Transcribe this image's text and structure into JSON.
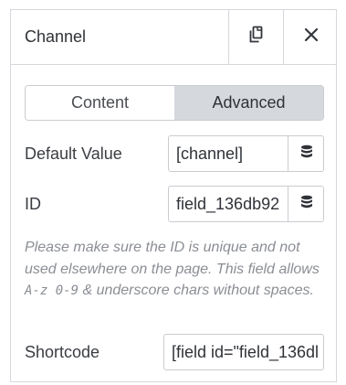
{
  "header": {
    "title": "Channel"
  },
  "tabs": [
    {
      "label": "Content",
      "active": false
    },
    {
      "label": "Advanced",
      "active": true
    }
  ],
  "fields": {
    "default_value": {
      "label": "Default Value",
      "value": "[channel]"
    },
    "id": {
      "label": "ID",
      "value": "field_136db92"
    },
    "shortcode": {
      "label": "Shortcode",
      "value": "[field id=\"field_136dl"
    }
  },
  "help": {
    "part1": "Please make sure the ID is unique and not used elsewhere on the page. This field allows ",
    "code": "A-z 0-9",
    "part2": " & underscore chars without spaces."
  },
  "icons": {
    "copy": "copy-icon",
    "close": "close-icon",
    "database": "database-icon"
  },
  "colors": {
    "border": "#d5d8dc",
    "active_tab": "#d5d8dc",
    "help_text": "#8a8e94"
  }
}
